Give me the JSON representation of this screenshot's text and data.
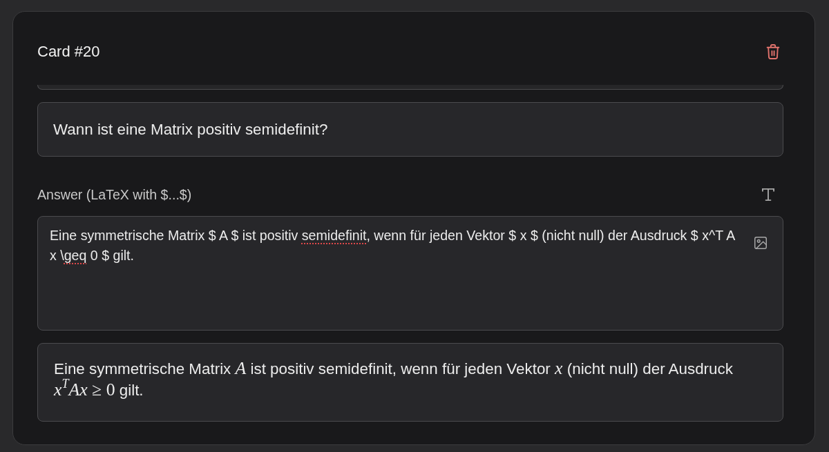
{
  "card": {
    "title": "Card #20"
  },
  "question": {
    "value": "Wann ist eine Matrix positiv semidefinit?"
  },
  "answer": {
    "label": "Answer (LaTeX with $...$)",
    "segments": [
      {
        "text": "Eine symmetrische Matrix $ A $ ist positiv ",
        "misspelled": false
      },
      {
        "text": "semidefinit",
        "misspelled": true
      },
      {
        "text": ", wenn für jeden Vektor $ x $ (nicht null) der Ausdruck $ x^T A x \\",
        "misspelled": false
      },
      {
        "text": "geq",
        "misspelled": true
      },
      {
        "text": " 0 $ gilt.",
        "misspelled": false
      }
    ]
  },
  "preview": {
    "segments": [
      {
        "kind": "text",
        "text": "Eine symmetrische Matrix "
      },
      {
        "kind": "var",
        "text": "A"
      },
      {
        "kind": "text",
        "text": " ist positiv semidefinit, wenn für jeden Vektor "
      },
      {
        "kind": "var",
        "text": "x"
      },
      {
        "kind": "text",
        "text": " (nicht null) der Ausdruck "
      },
      {
        "kind": "formula",
        "text": "*x*$^{T}$*Ax* ≥ 0"
      },
      {
        "kind": "text",
        "text": " gilt."
      }
    ]
  }
}
